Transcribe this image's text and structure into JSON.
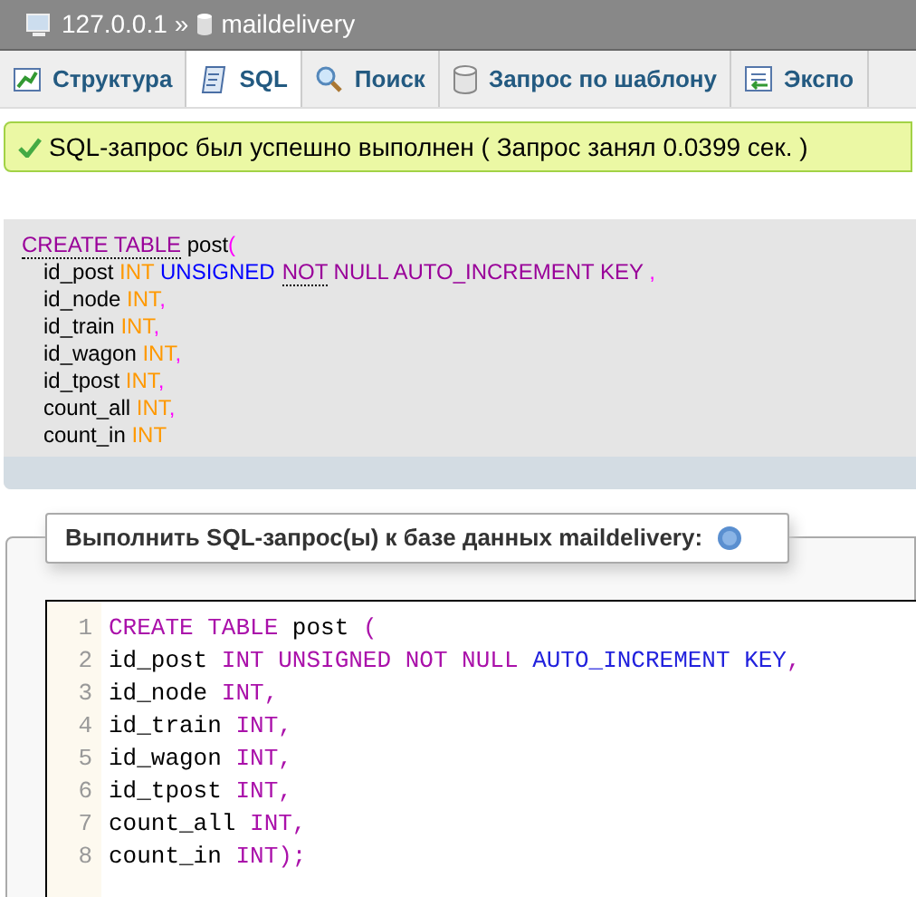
{
  "breadcrumb": {
    "server": "127.0.0.1",
    "separator": "»",
    "database": "maildelivery"
  },
  "tabs": [
    {
      "label": "Структура",
      "kind": "structure",
      "selected": false
    },
    {
      "label": "SQL",
      "kind": "sql",
      "selected": true
    },
    {
      "label": "Поиск",
      "kind": "search",
      "selected": false
    },
    {
      "label": "Запрос по шаблону",
      "kind": "database",
      "selected": false
    },
    {
      "label": "Экспо",
      "kind": "export",
      "selected": false
    }
  ],
  "message": {
    "text": "SQL-запрос был успешно выполнен ( Запрос занял 0.0399 сек. )"
  },
  "query": [
    [
      {
        "t": "CREATE TABLE",
        "kind": "keyword",
        "dotted": true
      },
      {
        "t": " post",
        "kind": "plain",
        "dotted": false
      },
      {
        "t": "(",
        "kind": "punct",
        "dotted": false
      }
    ],
    [
      {
        "t": "id_post",
        "kind": "plain",
        "dotted": false
      },
      {
        "t": " INT",
        "kind": "type",
        "dotted": false
      },
      {
        "t": " UNSIGNED",
        "kind": "attr",
        "dotted": false
      },
      {
        "t": "NOT",
        "kind": "keyword",
        "dotted": true
      },
      {
        "t": " NULL AUTO_INCREMENT KEY",
        "kind": "keyword",
        "dotted": false
      },
      {
        "t": " ,",
        "kind": "punct",
        "dotted": false
      }
    ],
    [
      {
        "t": "id_node",
        "kind": "plain",
        "dotted": false
      },
      {
        "t": " INT",
        "kind": "type",
        "dotted": false
      },
      {
        "t": ",",
        "kind": "punct",
        "dotted": false
      }
    ],
    [
      {
        "t": "id_train",
        "kind": "plain",
        "dotted": false
      },
      {
        "t": " INT",
        "kind": "type",
        "dotted": false
      },
      {
        "t": ",",
        "kind": "punct",
        "dotted": false
      }
    ],
    [
      {
        "t": "id_wagon",
        "kind": "plain",
        "dotted": false
      },
      {
        "t": " INT",
        "kind": "type",
        "dotted": false
      },
      {
        "t": ",",
        "kind": "punct",
        "dotted": false
      }
    ],
    [
      {
        "t": "id_tpost",
        "kind": "plain",
        "dotted": false
      },
      {
        "t": " INT",
        "kind": "type",
        "dotted": false
      },
      {
        "t": ",",
        "kind": "punct",
        "dotted": false
      }
    ],
    [
      {
        "t": "count_all",
        "kind": "plain",
        "dotted": false
      },
      {
        "t": " INT",
        "kind": "type",
        "dotted": false
      },
      {
        "t": ",",
        "kind": "punct",
        "dotted": false
      }
    ],
    [
      {
        "t": "count_in",
        "kind": "plain",
        "dotted": false
      },
      {
        "t": " INT",
        "kind": "type",
        "dotted": false
      }
    ]
  ],
  "form": {
    "legend": "Выполнить SQL-запрос(ы) к базе данных maildelivery:"
  },
  "editor": [
    {
      "n": "1",
      "tokens": [
        {
          "t": "CREATE TABLE",
          "kind": "keyword"
        },
        {
          "t": " post ",
          "kind": "plain"
        },
        {
          "t": "(",
          "kind": "punct"
        }
      ]
    },
    {
      "n": "2",
      "tokens": [
        {
          "t": "id_post ",
          "kind": "plain"
        },
        {
          "t": "INT UNSIGNED NOT NULL ",
          "kind": "keyword"
        },
        {
          "t": "AUTO_INCREMENT KEY",
          "kind": "attr"
        },
        {
          "t": ",",
          "kind": "punct"
        }
      ]
    },
    {
      "n": "3",
      "tokens": [
        {
          "t": "id_node ",
          "kind": "plain"
        },
        {
          "t": "INT",
          "kind": "keyword"
        },
        {
          "t": ",",
          "kind": "punct"
        }
      ]
    },
    {
      "n": "4",
      "tokens": [
        {
          "t": "id_train ",
          "kind": "plain"
        },
        {
          "t": "INT",
          "kind": "keyword"
        },
        {
          "t": ",",
          "kind": "punct"
        }
      ]
    },
    {
      "n": "5",
      "tokens": [
        {
          "t": "id_wagon ",
          "kind": "plain"
        },
        {
          "t": "INT",
          "kind": "keyword"
        },
        {
          "t": ",",
          "kind": "punct"
        }
      ]
    },
    {
      "n": "6",
      "tokens": [
        {
          "t": "id_tpost ",
          "kind": "plain"
        },
        {
          "t": "INT",
          "kind": "keyword"
        },
        {
          "t": ",",
          "kind": "punct"
        }
      ]
    },
    {
      "n": "7",
      "tokens": [
        {
          "t": "count_all ",
          "kind": "plain"
        },
        {
          "t": "INT",
          "kind": "keyword"
        },
        {
          "t": ",",
          "kind": "punct"
        }
      ]
    },
    {
      "n": "8",
      "tokens": [
        {
          "t": "count_in ",
          "kind": "plain"
        },
        {
          "t": "INT",
          "kind": "keyword"
        },
        {
          "t": ");",
          "kind": "punct"
        }
      ]
    }
  ]
}
